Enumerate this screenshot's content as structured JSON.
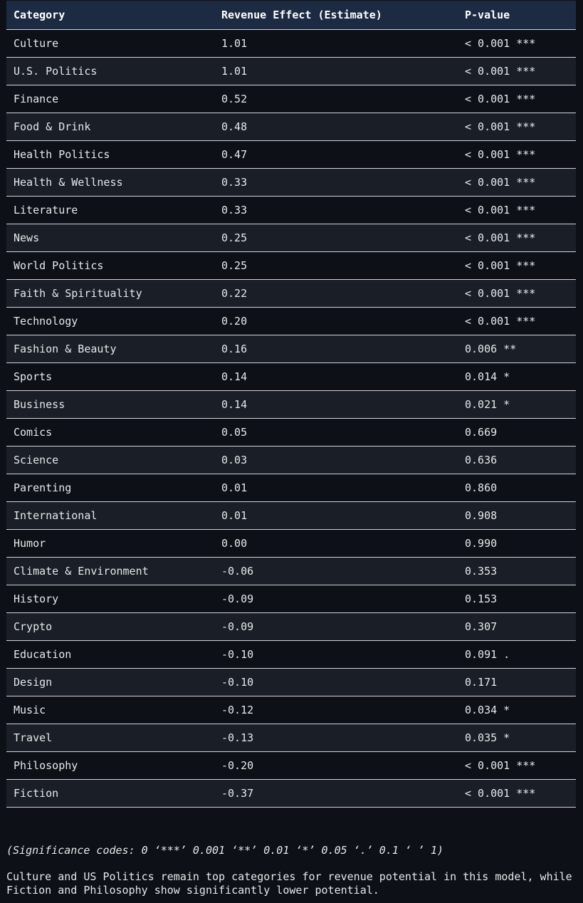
{
  "table": {
    "headers": [
      "Category",
      "Revenue Effect (Estimate)",
      "P-value"
    ],
    "rows": [
      [
        "Culture",
        "1.01",
        "< 0.001 ***"
      ],
      [
        "U.S. Politics",
        "1.01",
        "< 0.001 ***"
      ],
      [
        "Finance",
        "0.52",
        "< 0.001 ***"
      ],
      [
        "Food & Drink",
        "0.48",
        "< 0.001 ***"
      ],
      [
        "Health Politics",
        "0.47",
        "< 0.001 ***"
      ],
      [
        "Health & Wellness",
        "0.33",
        "< 0.001 ***"
      ],
      [
        "Literature",
        "0.33",
        "< 0.001 ***"
      ],
      [
        "News",
        "0.25",
        "< 0.001 ***"
      ],
      [
        "World Politics",
        "0.25",
        "< 0.001 ***"
      ],
      [
        "Faith & Spirituality",
        "0.22",
        "< 0.001 ***"
      ],
      [
        "Technology",
        "0.20",
        "< 0.001 ***"
      ],
      [
        "Fashion & Beauty",
        "0.16",
        "0.006 **"
      ],
      [
        "Sports",
        "0.14",
        "0.014 *"
      ],
      [
        "Business",
        "0.14",
        "0.021 *"
      ],
      [
        "Comics",
        "0.05",
        "0.669"
      ],
      [
        "Science",
        "0.03",
        "0.636"
      ],
      [
        "Parenting",
        "0.01",
        "0.860"
      ],
      [
        "International",
        "0.01",
        "0.908"
      ],
      [
        "Humor",
        "0.00",
        "0.990"
      ],
      [
        "Climate & Environment",
        "-0.06",
        "0.353"
      ],
      [
        "History",
        "-0.09",
        "0.153"
      ],
      [
        "Crypto",
        "-0.09",
        "0.307"
      ],
      [
        "Education",
        "-0.10",
        "0.091 ."
      ],
      [
        "Design",
        "-0.10",
        "0.171"
      ],
      [
        "Music",
        "-0.12",
        "0.034 *"
      ],
      [
        "Travel",
        "-0.13",
        "0.035 *"
      ],
      [
        "Philosophy",
        "-0.20",
        "< 0.001 ***"
      ],
      [
        "Fiction",
        "-0.37",
        "< 0.001 ***"
      ]
    ]
  },
  "significance_codes": "(Significance codes: 0 ‘***’ 0.001 ‘**’ 0.01 ‘*’ 0.05 ‘.’ 0.1 ‘ ’ 1)",
  "summary": "Culture and US Politics remain top categories for revenue potential in this model, while Fiction and Philosophy show significantly lower potential.",
  "colors": {
    "background": "#0d1117",
    "header_background": "#1c2a42",
    "row_alt_background": "#1a1e26",
    "rule": "#d0d4da",
    "text": "#e6e8ea"
  }
}
